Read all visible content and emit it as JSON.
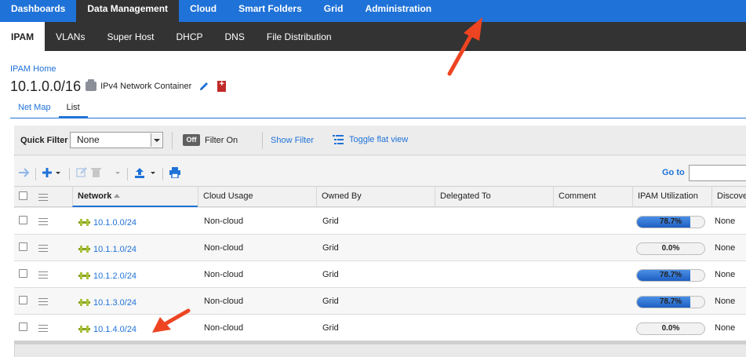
{
  "topnav": {
    "items": [
      "Dashboards",
      "Data Management",
      "Cloud",
      "Smart Folders",
      "Grid",
      "Administration"
    ],
    "active": "Data Management"
  },
  "subnav": {
    "items": [
      "IPAM",
      "VLANs",
      "Super Host",
      "DHCP",
      "DNS",
      "File Distribution"
    ],
    "active": "IPAM"
  },
  "header": {
    "breadcrumb": "IPAM Home",
    "title": "10.1.0.0/16",
    "container_type": "IPv4 Network Container"
  },
  "tabs": [
    "Net Map",
    "List"
  ],
  "active_tab": "List",
  "filter": {
    "quick_filter_label": "Quick Filter",
    "quick_filter_value": "None",
    "toggle_label": "Off",
    "filter_on_label": "Filter On",
    "show_filter": "Show Filter",
    "toggle_flat_view": "Toggle flat view"
  },
  "toolbar": {
    "goto_label": "Go to",
    "goto_value": ""
  },
  "table": {
    "columns": [
      "Network",
      "Cloud Usage",
      "Owned By",
      "Delegated To",
      "Comment",
      "IPAM Utilization",
      "Discove"
    ],
    "rows": [
      {
        "network": "10.1.0.0/24",
        "cloud_usage": "Non-cloud",
        "owned_by": "Grid",
        "delegated_to": "",
        "comment": "",
        "utilization": 78.7,
        "utilization_label": "78.7%",
        "discovery": "None"
      },
      {
        "network": "10.1.1.0/24",
        "cloud_usage": "Non-cloud",
        "owned_by": "Grid",
        "delegated_to": "",
        "comment": "",
        "utilization": 0.0,
        "utilization_label": "0.0%",
        "discovery": "None"
      },
      {
        "network": "10.1.2.0/24",
        "cloud_usage": "Non-cloud",
        "owned_by": "Grid",
        "delegated_to": "",
        "comment": "",
        "utilization": 78.7,
        "utilization_label": "78.7%",
        "discovery": "None"
      },
      {
        "network": "10.1.3.0/24",
        "cloud_usage": "Non-cloud",
        "owned_by": "Grid",
        "delegated_to": "",
        "comment": "",
        "utilization": 78.7,
        "utilization_label": "78.7%",
        "discovery": "None"
      },
      {
        "network": "10.1.4.0/24",
        "cloud_usage": "Non-cloud",
        "owned_by": "Grid",
        "delegated_to": "",
        "comment": "",
        "utilization": 0.0,
        "utilization_label": "0.0%",
        "discovery": "None"
      }
    ]
  },
  "colors": {
    "brand_blue": "#1f72d8",
    "nav_dark": "#333333",
    "annotation_red": "#ee4422"
  }
}
